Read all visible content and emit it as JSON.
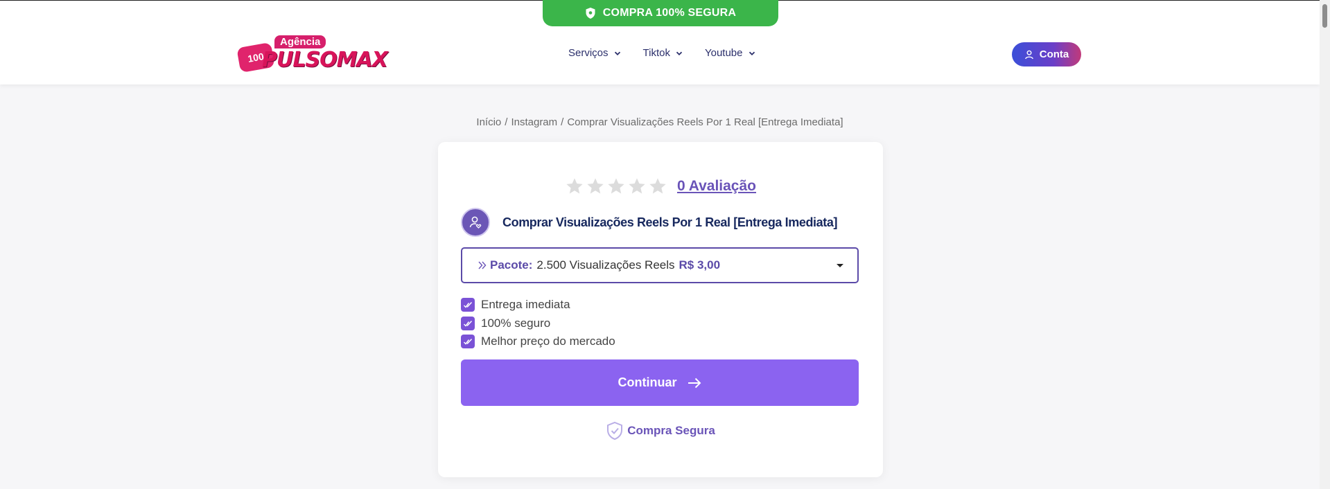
{
  "banner": {
    "text": "COMPRA 100% SEGURA",
    "icon": "shield-icon"
  },
  "logo": {
    "badge": "Agência",
    "wordmark": "PULSOMAX",
    "number": "100"
  },
  "nav": [
    {
      "label": "Serviços"
    },
    {
      "label": "Tiktok"
    },
    {
      "label": "Youtube"
    }
  ],
  "account": {
    "label": "Conta",
    "icon": "user-icon"
  },
  "breadcrumb": {
    "home": "Início",
    "category": "Instagram",
    "current": "Comprar Visualizações Reels Por 1 Real [Entrega Imediata]"
  },
  "product": {
    "rating_value": 0,
    "rating_max": 5,
    "rating_link": "0 Avaliação",
    "title": "Comprar Visualizações Reels Por 1 Real [Entrega Imediata]",
    "package": {
      "label": "Pacote:",
      "value": "2.500 Visualizações Reels",
      "price": "R$ 3,00"
    },
    "features": [
      "Entrega imediata",
      "100% seguro",
      "Melhor preço do mercado"
    ],
    "continue_label": "Continuar",
    "secure_label": "Compra Segura"
  },
  "colors": {
    "banner_green": "#3bb54a",
    "brand_purple": "#8b63f0",
    "dark_purple": "#5b4aa8",
    "title_navy": "#17285e"
  }
}
